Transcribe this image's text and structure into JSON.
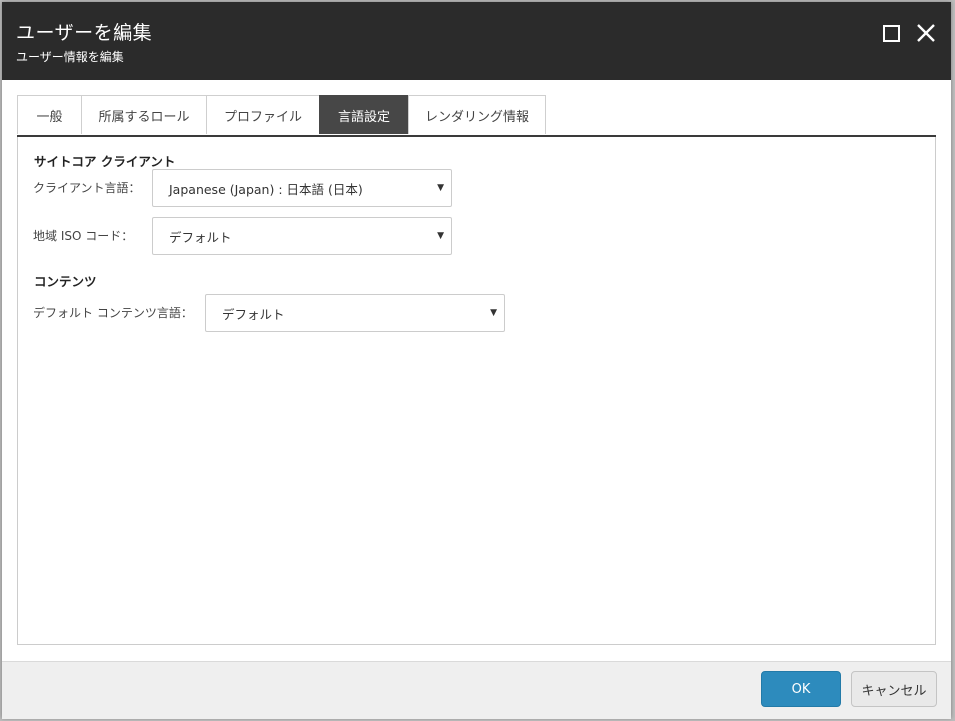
{
  "dialog": {
    "title": "ユーザーを編集",
    "subtitle": "ユーザー情報を編集",
    "maximize_icon": "maximize-icon",
    "close_icon": "close-icon"
  },
  "tabs": [
    {
      "label": "一般",
      "active": false
    },
    {
      "label": "所属するロール",
      "active": false
    },
    {
      "label": "プロファイル",
      "active": false
    },
    {
      "label": "言語設定",
      "active": true
    },
    {
      "label": "レンダリング情報",
      "active": false
    }
  ],
  "sections": {
    "client": {
      "title": "サイトコア クライアント",
      "client_language_label": "クライアント言語：",
      "client_language_value": "Japanese (Japan) : 日本語 (日本)",
      "region_iso_label": "地域 ISO コード：",
      "region_iso_value": "デフォルト"
    },
    "content": {
      "title": "コンテンツ",
      "default_content_language_label": "デフォルト コンテンツ言語：",
      "default_content_language_value": "デフォルト"
    }
  },
  "footer": {
    "ok_label": "OK",
    "cancel_label": "キャンセル"
  },
  "colors": {
    "titlebar": "#2b2b2b",
    "active_tab": "#474747",
    "ok_button": "#2d8bbd"
  }
}
